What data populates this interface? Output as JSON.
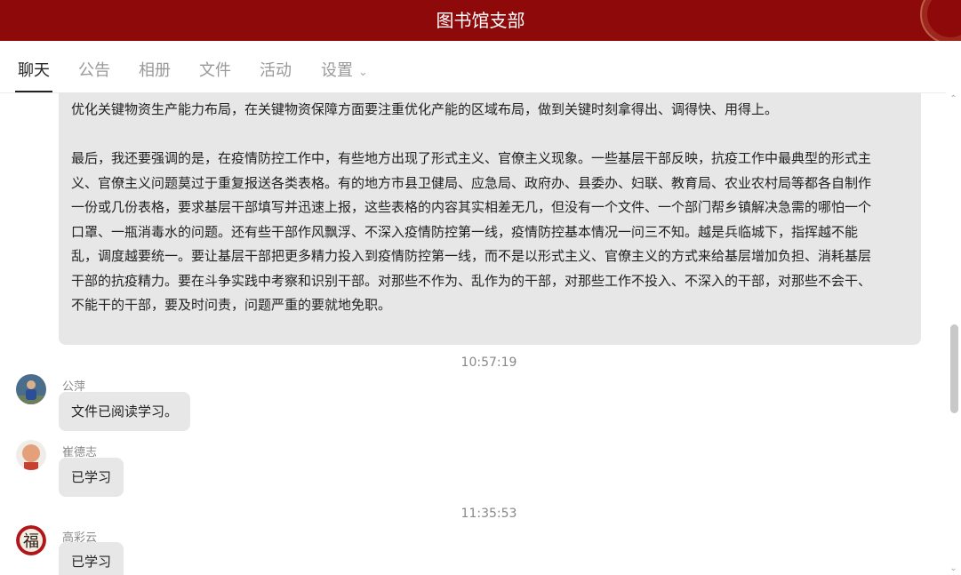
{
  "header": {
    "title": "图书馆支部"
  },
  "tabs": [
    {
      "label": "聊天"
    },
    {
      "label": "公告"
    },
    {
      "label": "相册"
    },
    {
      "label": "文件"
    },
    {
      "label": "活动"
    },
    {
      "label": "设置"
    }
  ],
  "icons": {
    "settings_dropdown": "chevron-down-icon",
    "scroll_up": "chevron-up-icon",
    "scroll_down": "chevron-down-icon"
  },
  "message_long": {
    "lines": [
      "优化关键物资生产能力布局，在关键物资保障方面要注重优化产能的区域布局，做到关键时刻拿得出、调得快、用得上。",
      "最后，我还要强调的是，在疫情防控工作中，有些地方出现了形式主义、官僚主义现象。一些基层干部反映，抗疫工作中最典型的形式主",
      "义、官僚主义问题莫过于重复报送各类表格。有的地方市县卫健局、应急局、政府办、县委办、妇联、教育局、农业农村局等都各自制作",
      "一份或几份表格，要求基层干部填写并迅速上报，这些表格的内容其实相差无几，但没有一个文件、一个部门帮乡镇解决急需的哪怕一个",
      "口罩、一瓶消毒水的问题。还有些干部作风飘浮、不深入疫情防控第一线，疫情防控基本情况一问三不知。越是兵临城下，指挥越不能",
      "乱，调度越要统一。要让基层干部把更多精力投入到疫情防控第一线，而不是以形式主义、官僚主义的方式来给基层增加负担、消耗基层",
      "干部的抗疫精力。要在斗争实践中考察和识别干部。对那些不作为、乱作为的干部，对那些工作不投入、不深入的干部，对那些不会干、",
      "不能干的干部，要及时问责，问题严重的要就地免职。"
    ]
  },
  "time1": "10:57:19",
  "msg1": {
    "name": "公萍",
    "text": "文件已阅读学习。"
  },
  "msg2": {
    "name": "崔德志",
    "text": "已学习"
  },
  "time2": "11:35:53",
  "msg3": {
    "name": "高彩云",
    "text": "已学习",
    "avatar_char": "福"
  },
  "colors": {
    "header_bg": "#8e0a0a",
    "bubble_bg": "#e7e7e7"
  }
}
